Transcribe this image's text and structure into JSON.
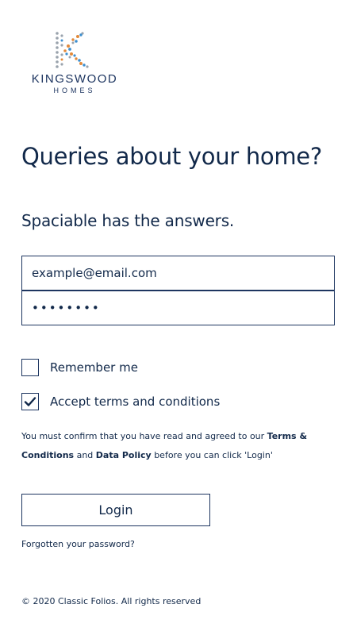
{
  "brand": {
    "logo_icon": "kingswood-dots-k-icon",
    "name": "KINGSWOOD",
    "sub": "HOMES",
    "colors": {
      "orange": "#e28a3b",
      "blue": "#3d8fcf",
      "grey": "#9aa3ad"
    }
  },
  "headline": "Queries about your home?",
  "subheadline": "Spaciable has the answers.",
  "form": {
    "email_value": "example@email.com",
    "password_value": "••••••••",
    "remember_label": "Remember me",
    "remember_checked": false,
    "accept_label": "Accept terms and conditions",
    "accept_checked": true
  },
  "notice": {
    "prefix": "You must confirm that you have read and agreed to our ",
    "terms_link": "Terms & Conditions",
    "middle": " and ",
    "policy_link": "Data Policy",
    "suffix": " before you can click 'Login'"
  },
  "login_label": "Login",
  "forgot_label": "Forgotten your password?",
  "footer": "© 2020 Classic Folios. All rights reserved",
  "colors": {
    "text": "#12294a",
    "border": "#1d3560"
  }
}
